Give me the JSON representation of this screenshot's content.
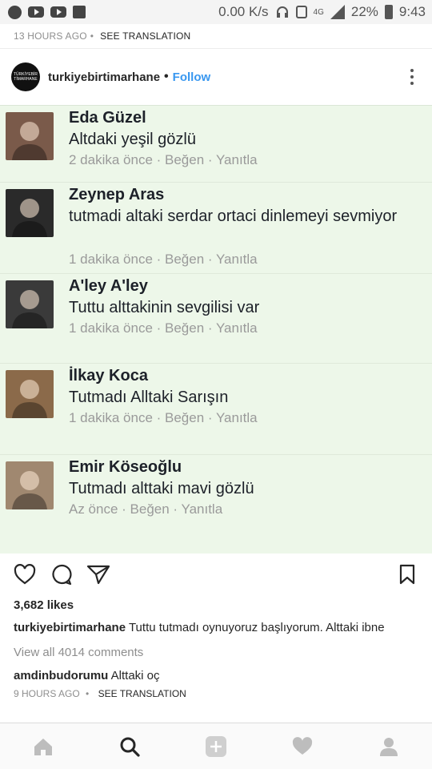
{
  "status_bar": {
    "speed": "0.00 K/s",
    "network": "4G",
    "battery": "22%",
    "time": "9:43"
  },
  "previous_post": {
    "time": "13 HOURS AGO",
    "see_translation": "SEE TRANSLATION"
  },
  "post": {
    "username": "turkiyebirtimarhane",
    "follow_label": "Follow",
    "logo_text": "TÜRKİYEBİR TİMARHANE",
    "image": {
      "comments": [
        {
          "name": "Eda Güzel",
          "text": "Altdaki yeşil gözlü",
          "meta": "2 dakika önce · Beğen · Yanıtla",
          "photo_color": "#7a5a4a"
        },
        {
          "name": "Zeynep Aras",
          "text": "tutmadi altaki serdar ortaci dinlemeyi sevmiyor",
          "meta": "1 dakika önce · Beğen · Yanıtla",
          "photo_color": "#2a2a2a"
        },
        {
          "name": "A'ley A'ley",
          "text": "Tuttu alttakinin sevgilisi var",
          "meta": "1 dakika önce · Beğen · Yanıtla",
          "photo_color": "#3a3a3a"
        },
        {
          "name": "İlkay Koca",
          "text": "Tutmadı  Alltaki Sarışın",
          "meta": "1 dakika önce · Beğen · Yanıtla",
          "photo_color": "#8b6a4a"
        },
        {
          "name": "Emir Köseoğlu",
          "text": "Tutmadı alttaki mavi gözlü",
          "meta": "Az önce · Beğen · Yanıtla",
          "photo_color": "#a08870"
        }
      ]
    },
    "likes": "3,682 likes",
    "caption_user": "turkiyebirtimarhane",
    "caption_text": "Tuttu tutmadı oynuyoruz başlıyorum. Alttaki ibne",
    "view_all": "View all 4014 comments",
    "reply_user": "amdinbudorumu",
    "reply_text": "Alttaki oç",
    "time": "9 HOURS AGO",
    "see_translation": "SEE TRANSLATION"
  },
  "colors": {
    "accent": "#3897f0",
    "image_bg": "#edf7e9"
  },
  "icons": [
    "heart-icon",
    "comment-icon",
    "share-icon",
    "bookmark-icon",
    "home-icon",
    "search-icon",
    "add-icon",
    "activity-heart-icon",
    "profile-icon"
  ]
}
